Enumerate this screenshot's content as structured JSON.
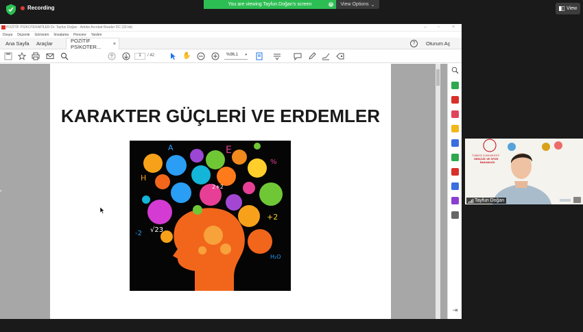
{
  "zoom": {
    "recording_label": "Recording",
    "viewing_banner": "You are viewing Tayfun Doğan's screen",
    "view_options_label": "View Options",
    "view_button_label": "View"
  },
  "acrobat": {
    "window_title": "POZİTİF PSİKOTERAPİLER Dr. Tayfun Doğan - Adobe Acrobat Reader DC (32-bit)",
    "menu": [
      "Dosya",
      "Düzenle",
      "Görünüm",
      "İmzalama",
      "Pencere",
      "Yardım"
    ],
    "tabs": {
      "home": "Ana Sayfa",
      "tools": "Araçlar",
      "document": "POZİTİF PSİKOTER..."
    },
    "sign_in": "Oturum Aç",
    "page_current": "1",
    "page_total": "/ 42",
    "zoom_value": "%96,1"
  },
  "slide": {
    "title": "KARAKTER GÜÇLERİ VE ERDEMLER"
  },
  "participant": {
    "name": "Tayfun Doğan"
  },
  "colors": {
    "zoom_bg": "#1a1a1a",
    "banner_green": "#2dbe53",
    "record_red": "#e03b3b",
    "doc_gray": "#a7a7a7"
  }
}
